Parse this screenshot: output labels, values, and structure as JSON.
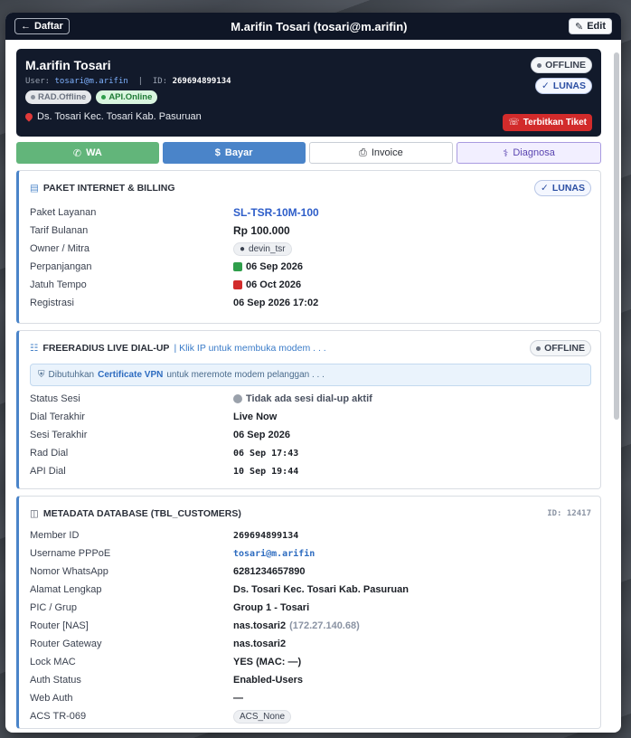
{
  "topbar": {
    "back_label": "Daftar",
    "title": "M.arifin Tosari (tosari@m.arifin)",
    "edit_label": "Edit"
  },
  "profile": {
    "name": "M.arifin Tosari",
    "user_label": "User:",
    "username": "tosari@m.arifin",
    "id_label": "ID:",
    "id": "269694899134",
    "rad_badge": "RAD.Offline",
    "api_badge": "API.Online",
    "address": "Ds. Tosari Kec. Tosari Kab. Pasuruan",
    "status": "OFFLINE",
    "payment": "LUNAS",
    "ticket_label": "Terbitkan Tiket"
  },
  "actions": {
    "wa": "WA",
    "bayar": "Bayar",
    "invoice": "Invoice",
    "diagnosa": "Diagnosa"
  },
  "billing": {
    "title": "PAKET INTERNET & BILLING",
    "badge": "LUNAS",
    "rows": [
      {
        "k": "Paket Layanan",
        "v": "SL-TSR-10M-100"
      },
      {
        "k": "Tarif Bulanan",
        "v": "Rp 100.000"
      },
      {
        "k": "Owner / Mitra",
        "v": "devin_tsr"
      },
      {
        "k": "Perpanjangan",
        "v": "06 Sep 2026"
      },
      {
        "k": "Jatuh Tempo",
        "v": "06 Oct 2026"
      },
      {
        "k": "Registrasi",
        "v": "06 Sep 2026 17:02"
      }
    ]
  },
  "radius": {
    "title": "FREERADIUS LIVE DIAL-UP",
    "link": "Klik IP untuk membuka modem . . .",
    "badge": "OFFLINE",
    "notice_pre": "Dibutuhkan",
    "notice_link": "Certificate VPN",
    "notice_post": "untuk meremote modem pelanggan . . .",
    "rows": [
      {
        "k": "Status Sesi",
        "v": "Tidak ada sesi dial-up aktif"
      },
      {
        "k": "Dial Terakhir",
        "v": "Live Now"
      },
      {
        "k": "Sesi Terakhir",
        "v": "06 Sep 2026"
      },
      {
        "k": "Rad Dial",
        "v": "06 Sep 17:43"
      },
      {
        "k": "API Dial",
        "v": "10 Sep 19:44"
      }
    ]
  },
  "metadata": {
    "title": "METADATA DATABASE (TBL_CUSTOMERS)",
    "id_tag": "ID: 12417",
    "rows": [
      {
        "k": "Member ID",
        "v": "269694899134"
      },
      {
        "k": "Username PPPoE",
        "v": "tosari@m.arifin"
      },
      {
        "k": "Nomor WhatsApp",
        "v": "6281234657890"
      },
      {
        "k": "Alamat Lengkap",
        "v": "Ds. Tosari Kec. Tosari Kab. Pasuruan"
      },
      {
        "k": "PIC / Grup",
        "v": "Group 1 - Tosari"
      },
      {
        "k": "Router [NAS]",
        "v": "nas.tosari2",
        "ip": "(172.27.140.68)"
      },
      {
        "k": "Router Gateway",
        "v": "nas.tosari2"
      },
      {
        "k": "Lock MAC",
        "v": "YES (MAC: —)"
      },
      {
        "k": "Auth Status",
        "v": "Enabled-Users"
      },
      {
        "k": "Web Auth",
        "v": "—"
      },
      {
        "k": "ACS TR-069",
        "v": "ACS_None"
      }
    ]
  }
}
